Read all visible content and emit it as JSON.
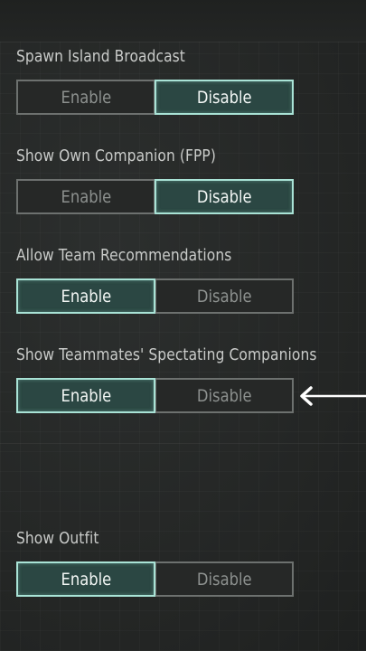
{
  "settings": [
    {
      "label": "Spawn Island Broadcast",
      "enable_label": "Enable",
      "disable_label": "Disable",
      "selected": "Disable"
    },
    {
      "label": "Show Own Companion (FPP)",
      "enable_label": "Enable",
      "disable_label": "Disable",
      "selected": "Disable"
    },
    {
      "label": "Allow Team Recommendations",
      "enable_label": "Enable",
      "disable_label": "Disable",
      "selected": "Enable"
    },
    {
      "label": "Show Teammates' Spectating Companions",
      "enable_label": "Enable",
      "disable_label": "Disable",
      "selected": "Enable"
    },
    {
      "label": "Show Outfit",
      "enable_label": "Enable",
      "disable_label": "Disable",
      "selected": "Enable"
    }
  ],
  "annotation": {
    "icon": "left-arrow-icon",
    "color": "#ffffff"
  },
  "colors": {
    "selected_border": "#a9e3d6",
    "selected_fill": "#2b4743",
    "unselected_border": "#6d716f",
    "background": "#262827"
  }
}
